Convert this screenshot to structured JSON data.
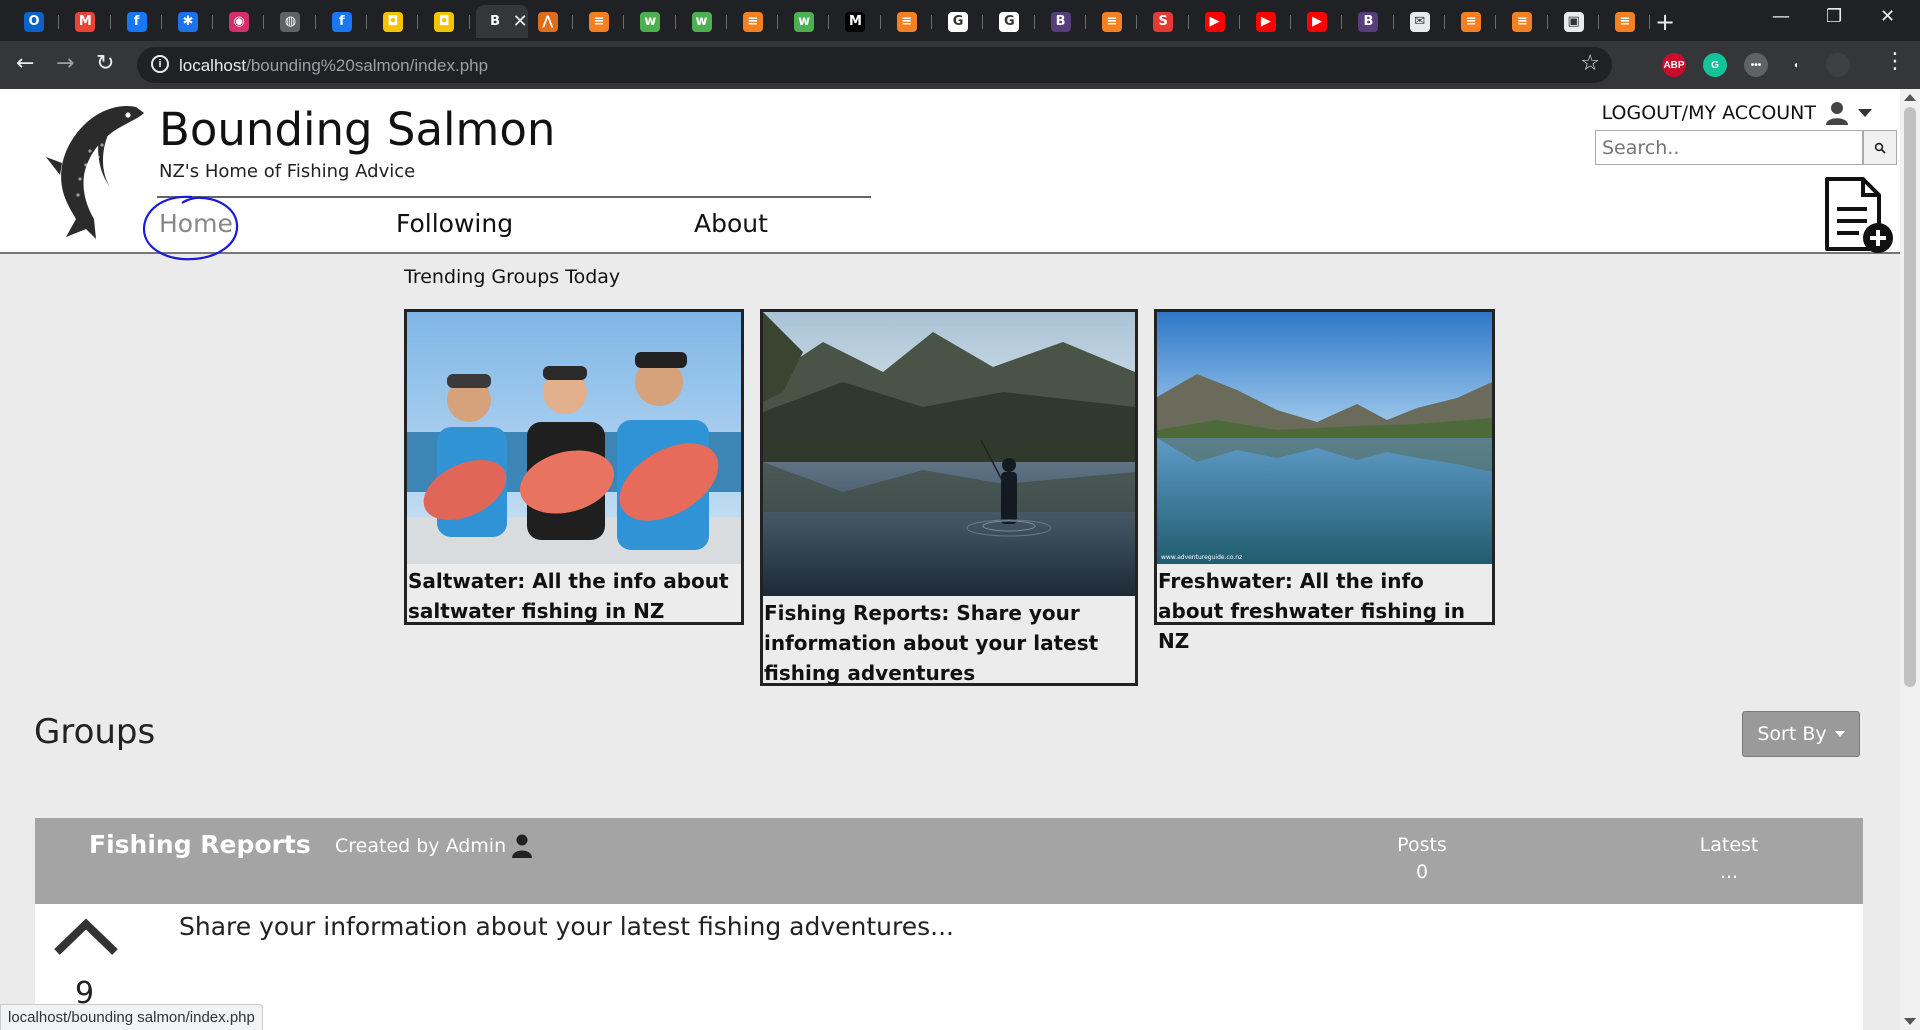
{
  "browser": {
    "tabs": [
      {
        "icon": "outlook-icon",
        "color": "#0a64c8",
        "glyph": "O"
      },
      {
        "icon": "gmail-icon",
        "color": "#ea4335",
        "glyph": "M"
      },
      {
        "icon": "facebook-icon",
        "color": "#1877f2",
        "glyph": "f"
      },
      {
        "icon": "app-icon",
        "color": "#1a73e8",
        "glyph": "✱"
      },
      {
        "icon": "app-icon",
        "color": "#d32f6b",
        "glyph": "◉"
      },
      {
        "icon": "globe-icon",
        "color": "#5f6368",
        "glyph": "◍"
      },
      {
        "icon": "facebook-icon",
        "color": "#1877f2",
        "glyph": "f"
      },
      {
        "icon": "app-icon",
        "color": "#f5c400",
        "glyph": "◘"
      },
      {
        "icon": "app-icon",
        "color": "#f5c400",
        "glyph": "◘"
      },
      {
        "icon": "site-icon",
        "color": "#35363a",
        "glyph": "B",
        "active": true
      },
      {
        "icon": "app-icon",
        "color": "#e06d1a",
        "glyph": "⋀"
      },
      {
        "icon": "stackoverflow-icon",
        "color": "#f48024",
        "glyph": "≡"
      },
      {
        "icon": "w3schools-icon",
        "color": "#4caf50",
        "glyph": "w"
      },
      {
        "icon": "w3schools-icon",
        "color": "#4caf50",
        "glyph": "w"
      },
      {
        "icon": "stackoverflow-icon",
        "color": "#f48024",
        "glyph": "≡"
      },
      {
        "icon": "w3schools-icon",
        "color": "#4caf50",
        "glyph": "w"
      },
      {
        "icon": "medium-icon",
        "color": "#000000",
        "glyph": "M"
      },
      {
        "icon": "stackoverflow-icon",
        "color": "#f48024",
        "glyph": "≡"
      },
      {
        "icon": "google-icon",
        "color": "#ffffff",
        "glyph": "G"
      },
      {
        "icon": "google-icon",
        "color": "#ffffff",
        "glyph": "G"
      },
      {
        "icon": "bootstrap-icon",
        "color": "#563d7c",
        "glyph": "B"
      },
      {
        "icon": "stackoverflow-icon",
        "color": "#f48024",
        "glyph": "≡"
      },
      {
        "icon": "app-icon",
        "color": "#e53935",
        "glyph": "S"
      },
      {
        "icon": "youtube-icon",
        "color": "#ff0000",
        "glyph": "▶"
      },
      {
        "icon": "youtube-icon",
        "color": "#ff0000",
        "glyph": "▶"
      },
      {
        "icon": "youtube-icon",
        "color": "#ff0000",
        "glyph": "▶"
      },
      {
        "icon": "bootstrap-icon",
        "color": "#563d7c",
        "glyph": "B"
      },
      {
        "icon": "mail-icon",
        "color": "#e8eaed",
        "glyph": "✉"
      },
      {
        "icon": "stackoverflow-icon",
        "color": "#f48024",
        "glyph": "≡"
      },
      {
        "icon": "stackoverflow-icon",
        "color": "#f48024",
        "glyph": "≡"
      },
      {
        "icon": "app-icon",
        "color": "#e8eaed",
        "glyph": "▣"
      },
      {
        "icon": "stackoverflow-icon",
        "color": "#f48024",
        "glyph": "≡"
      }
    ],
    "url_host": "localhost",
    "url_path": "/bounding%20salmon/index.php",
    "status_text": "localhost/bounding salmon/index.php",
    "extensions": [
      {
        "name": "adblock-icon",
        "label": "ABP",
        "color": "#c70d2c"
      },
      {
        "name": "grammarly-icon",
        "label": "G",
        "color": "#15c39a"
      },
      {
        "name": "extension-icon",
        "label": "•••",
        "color": "#5f6368"
      },
      {
        "name": "dark-mode-icon",
        "label": "◐",
        "color": "#35363a"
      },
      {
        "name": "profile-icon",
        "label": "",
        "color": "#3c4043"
      }
    ]
  },
  "site": {
    "title": "Bounding Salmon",
    "tagline": "NZ's Home of Fishing Advice",
    "nav": [
      "Home",
      "Following",
      "About"
    ],
    "account_label": "LOGOUT/MY ACCOUNT",
    "search_placeholder": "Search.."
  },
  "trending": {
    "title": "Trending Groups Today",
    "cards": [
      {
        "caption": "Saltwater: All the info about saltwater fishing in NZ"
      },
      {
        "caption": "Fishing Reports: Share your information about your latest fishing adventures"
      },
      {
        "caption": "Freshwater: All the info about freshwater fishing in NZ",
        "watermark": "www.adventureguide.co.nz"
      }
    ]
  },
  "groups": {
    "title": "Groups",
    "sort_label": "Sort By",
    "items": [
      {
        "name": "Fishing Reports",
        "creator": "Created by Admin",
        "posts_label": "Posts",
        "posts_value": "0",
        "latest_label": "Latest",
        "latest_value": "...",
        "description": "Share your information about your latest fishing adventures...",
        "votes": "9"
      }
    ]
  },
  "colors": {
    "chrome_dark": "#202124",
    "chrome_toolbar": "#35363a",
    "page_bg": "#ebebeb",
    "group_header": "#a4a4a4",
    "sort_button": "#9a9a9a",
    "annotation_circle": "#1a1adb"
  }
}
